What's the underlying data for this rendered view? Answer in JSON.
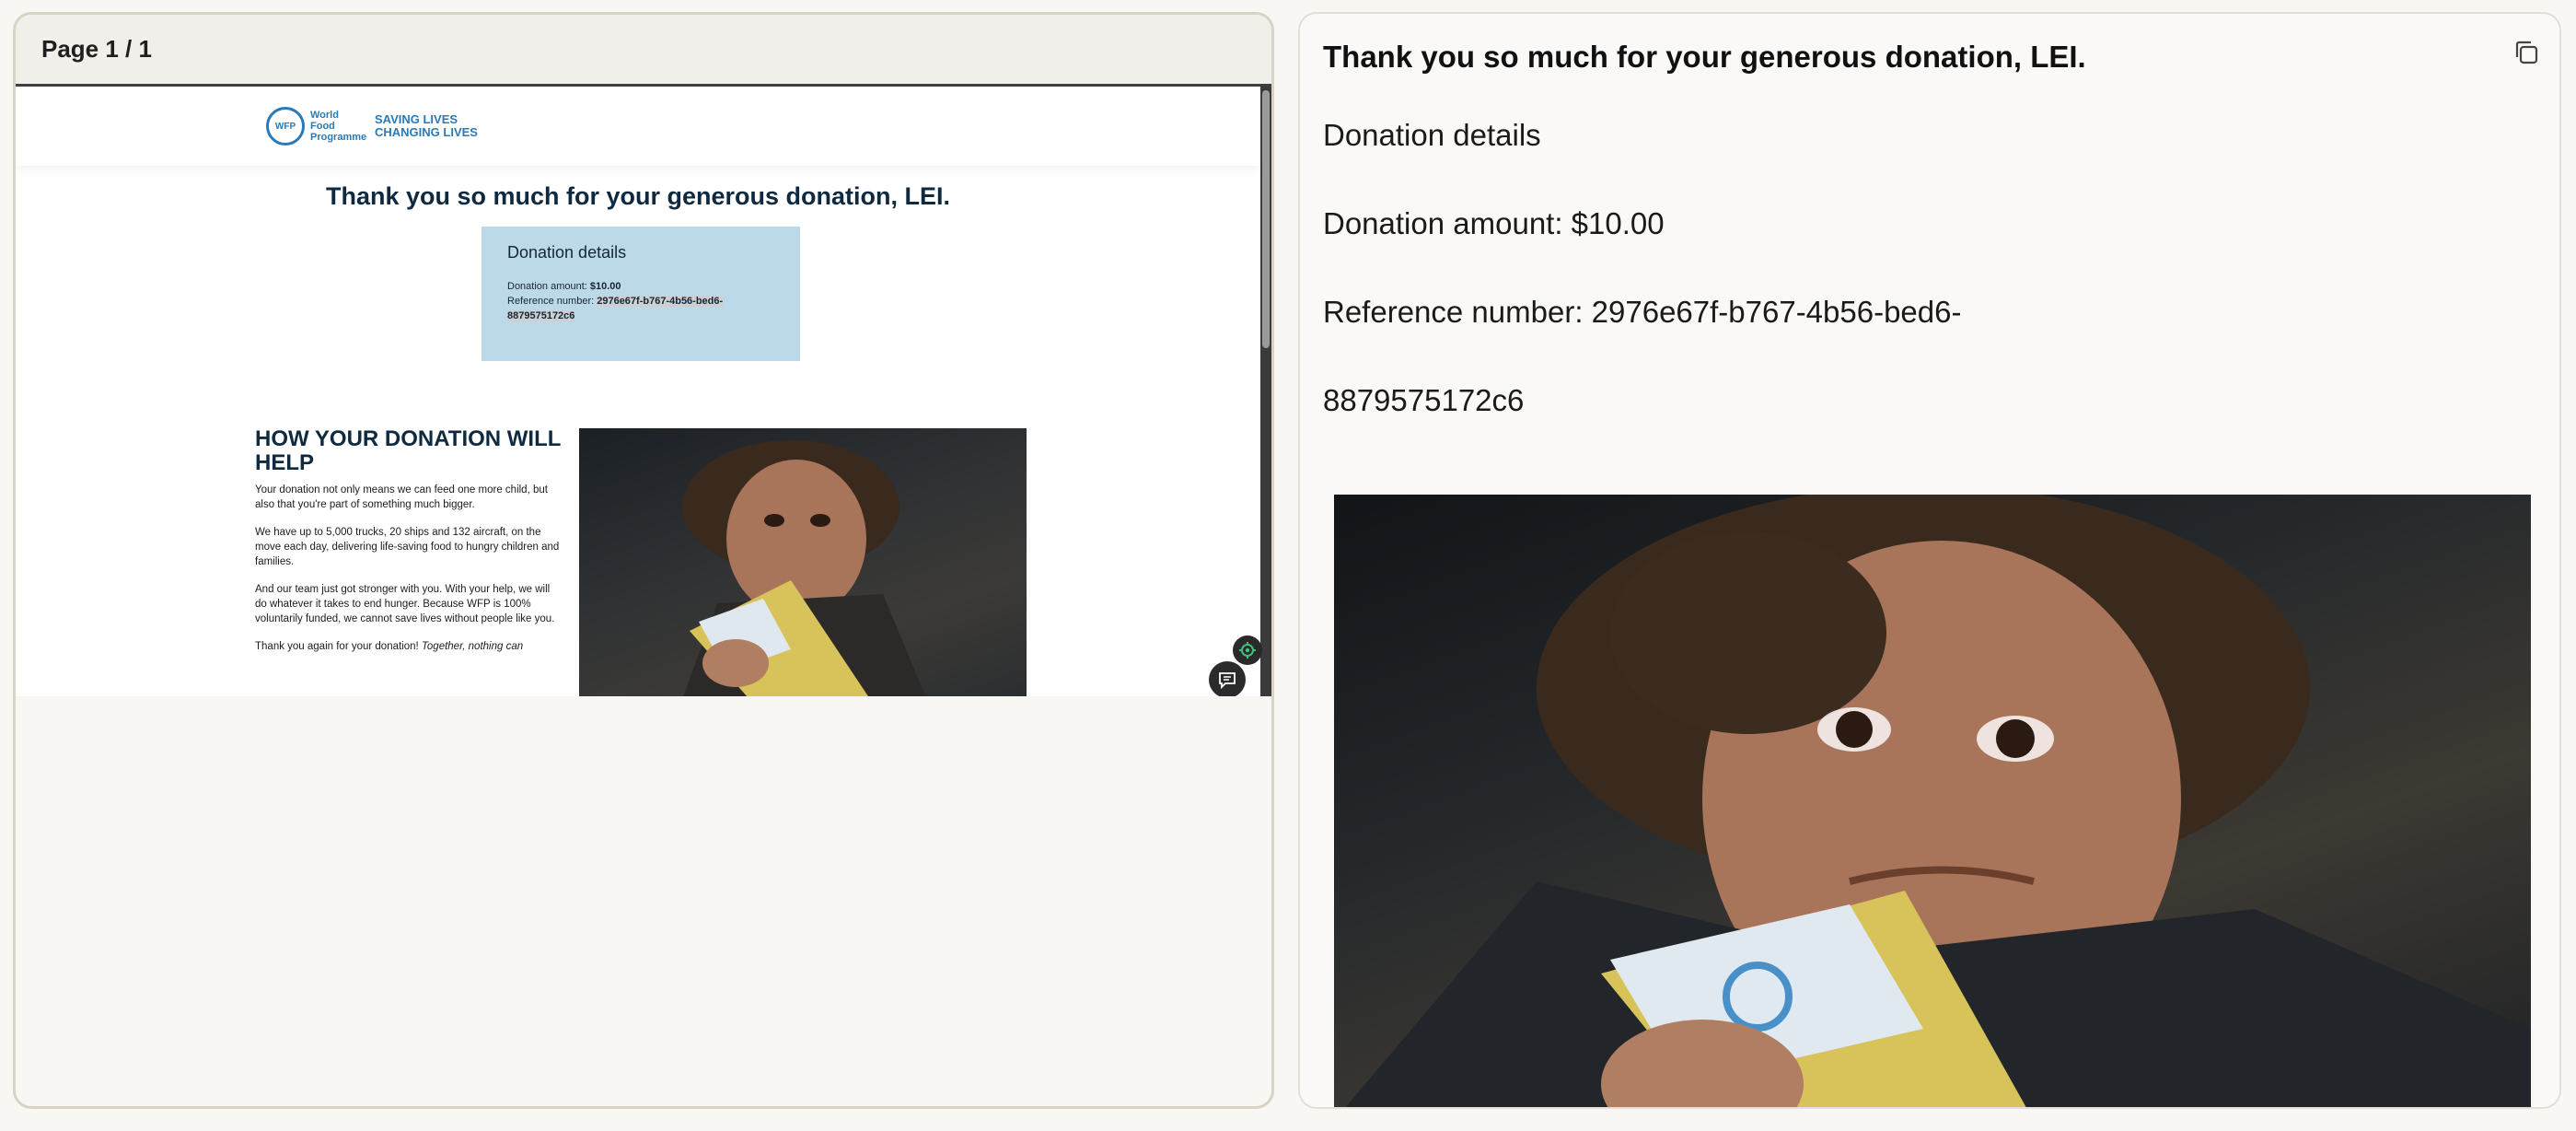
{
  "viewer": {
    "page_indicator": "Page 1 / 1"
  },
  "webpage": {
    "logo": {
      "emblem_text": "WFP",
      "org_name": "World Food Programme",
      "slogan_line1": "SAVING LIVES",
      "slogan_line2": "CHANGING LIVES"
    },
    "title": "Thank you so much for your generous donation, LEI.",
    "details": {
      "heading": "Donation details",
      "amount_label": "Donation amount: ",
      "amount_value": "$10.00",
      "reference_label": "Reference number: ",
      "reference_value_part1": "2976e67f-b767-4b56-bed6-",
      "reference_value_part2": "8879575172c6"
    },
    "help": {
      "title": "HOW YOUR DONATION WILL HELP",
      "p1": "Your donation not only means we can feed one more child, but also that you're part of something much bigger.",
      "p2": "We have up to 5,000 trucks, 20 ships and 132 aircraft, on the move each day, delivering life-saving food to hungry children and families.",
      "p3": "And our team just got stronger with you. With your help, we will do whatever it takes to end hunger. Because WFP is 100% voluntarily funded, we cannot save lives without people like you.",
      "p4_start": "Thank you again for your donation! ",
      "p4_italic": "Together, nothing can"
    }
  },
  "reply": {
    "heading": "Thank you so much for your generous donation, LEI.",
    "line1": "Donation details",
    "line2": "Donation amount: $10.00",
    "line3": "Reference number: 2976e67f-b767-4b56-bed6-",
    "line4": "8879575172c6"
  },
  "colors": {
    "wfp_blue": "#2a7ab8",
    "details_bg": "#bcd9e9",
    "heading_navy": "#0f2a40"
  },
  "icons": [
    "copy-icon",
    "settings-gear-icon",
    "chat-bubble-icon"
  ]
}
